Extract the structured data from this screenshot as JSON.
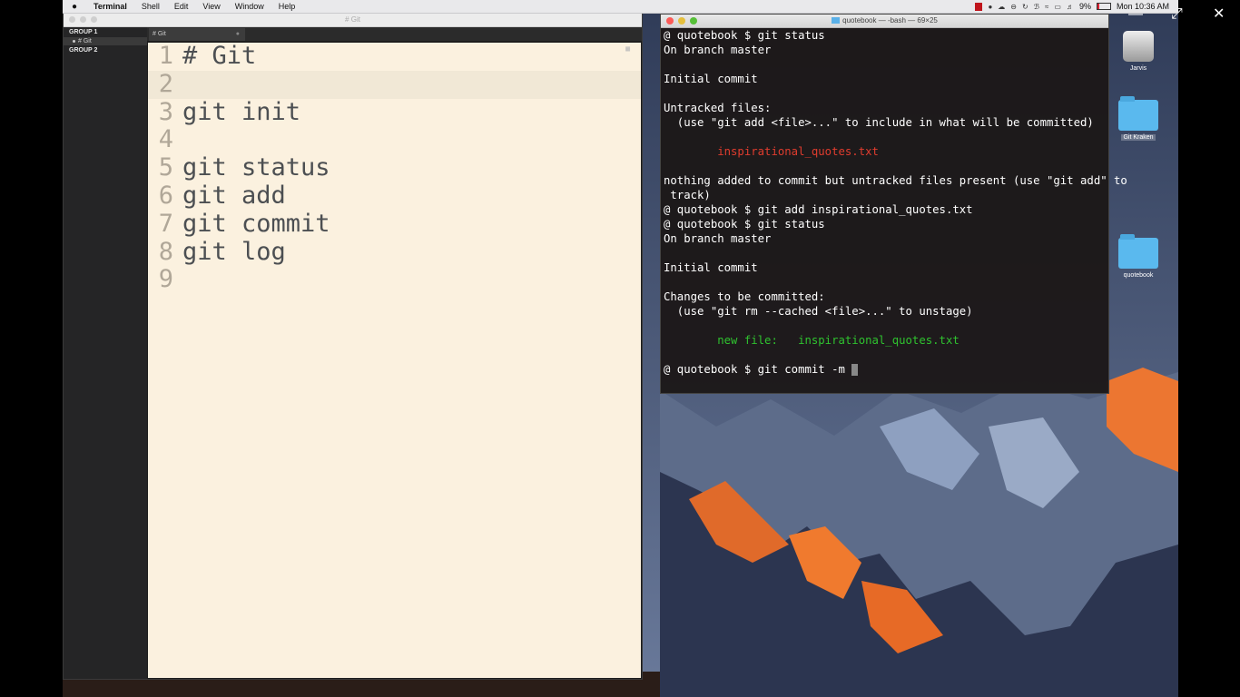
{
  "menubar": {
    "app": "Terminal",
    "items": [
      "Shell",
      "Edit",
      "View",
      "Window",
      "Help"
    ],
    "battery": "9%",
    "clock": "Mon 10:36 AM"
  },
  "editor": {
    "window_title": "# Git",
    "sidebar": {
      "group1": "GROUP 1",
      "file": "# Git",
      "group2": "GROUP 2"
    },
    "tab_label": "# Git",
    "lines": [
      {
        "n": "1",
        "text": "# Git"
      },
      {
        "n": "2",
        "text": ""
      },
      {
        "n": "3",
        "text": "git init"
      },
      {
        "n": "4",
        "text": ""
      },
      {
        "n": "5",
        "text": "git status"
      },
      {
        "n": "6",
        "text": "git add"
      },
      {
        "n": "7",
        "text": "git commit"
      },
      {
        "n": "8",
        "text": "git log"
      },
      {
        "n": "9",
        "text": ""
      }
    ]
  },
  "terminal": {
    "window_title": "quotebook — -bash — 69×25",
    "lines": [
      {
        "text": "@ quotebook $ git status",
        "color": "white"
      },
      {
        "text": "On branch master",
        "color": "white"
      },
      {
        "text": "",
        "color": "white"
      },
      {
        "text": "Initial commit",
        "color": "white"
      },
      {
        "text": "",
        "color": "white"
      },
      {
        "text": "Untracked files:",
        "color": "white"
      },
      {
        "text": "  (use \"git add <file>...\" to include in what will be committed)",
        "color": "white"
      },
      {
        "text": "",
        "color": "white"
      },
      {
        "text": "        inspirational_quotes.txt",
        "color": "red"
      },
      {
        "text": "",
        "color": "white"
      },
      {
        "text": "nothing added to commit but untracked files present (use \"git add\" to",
        "color": "white"
      },
      {
        "text": " track)",
        "color": "white"
      },
      {
        "text": "@ quotebook $ git add inspirational_quotes.txt",
        "color": "white"
      },
      {
        "text": "@ quotebook $ git status",
        "color": "white"
      },
      {
        "text": "On branch master",
        "color": "white"
      },
      {
        "text": "",
        "color": "white"
      },
      {
        "text": "Initial commit",
        "color": "white"
      },
      {
        "text": "",
        "color": "white"
      },
      {
        "text": "Changes to be committed:",
        "color": "white"
      },
      {
        "text": "  (use \"git rm --cached <file>...\" to unstage)",
        "color": "white"
      },
      {
        "text": "",
        "color": "white"
      },
      {
        "text": "        new file:   inspirational_quotes.txt",
        "color": "green"
      },
      {
        "text": "",
        "color": "white"
      }
    ],
    "prompt": "@ quotebook $ git commit -m "
  },
  "desktop": {
    "icons": [
      "Jarvis",
      "Git Kraken",
      "quotebook"
    ]
  },
  "colors": {
    "doc_bg": "#fbf1df",
    "terminal_red": "#e03c2e",
    "terminal_green": "#2fc22f"
  }
}
